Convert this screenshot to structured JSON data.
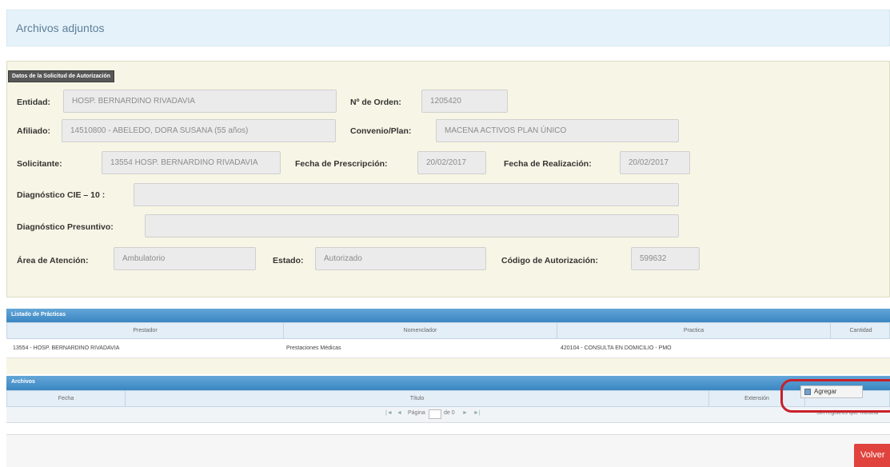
{
  "header": {
    "title": "Archivos adjuntos"
  },
  "solicitud": {
    "section_label": "Datos de la Solicitud de Autorización",
    "fields": {
      "entidad": {
        "label": "Entidad:",
        "value": "HOSP. BERNARDINO RIVADAVIA"
      },
      "nro_orden": {
        "label": "Nº de Orden:",
        "value": "1205420"
      },
      "afiliado": {
        "label": "Afiliado:",
        "value": "14510800 - ABELEDO, DORA SUSANA (55 años)"
      },
      "convenio": {
        "label": "Convenio/Plan:",
        "value": "MACENA ACTIVOS PLAN ÚNICO"
      },
      "solicitante": {
        "label": "Solicitante:",
        "value": "13554 HOSP. BERNARDINO RIVADAVIA"
      },
      "fecha_prescripcion": {
        "label": "Fecha de Prescripción:",
        "value": "20/02/2017"
      },
      "fecha_realizacion": {
        "label": "Fecha de Realización:",
        "value": "20/02/2017"
      },
      "diagnostico_cie": {
        "label": "Diagnóstico CIE – 10 :",
        "value": ""
      },
      "diagnostico_presuntivo": {
        "label": "Diagnóstico Presuntivo:",
        "value": ""
      },
      "area_atencion": {
        "label": "Área de Atención:",
        "value": "Ambulatorio"
      },
      "estado": {
        "label": "Estado:",
        "value": "Autorizado"
      },
      "codigo_autorizacion": {
        "label": "Código de Autorización:",
        "value": "599632"
      }
    }
  },
  "practicas": {
    "title": "Listado de Prácticas",
    "columns": [
      "Prestador",
      "Nomenclador",
      "Practica",
      "Cantidad"
    ],
    "rows": [
      {
        "prestador": "13554 - HOSP. BERNARDINO RIVADAVIA",
        "nomenclador": "Prestaciones Médicas",
        "practica": "420104 - CONSULTA EN DOMICILIO - PMO",
        "cantidad": ""
      }
    ]
  },
  "archivos": {
    "title": "Archivos",
    "columns": [
      "Fecha",
      "Título",
      "Extensión"
    ],
    "add_button_label": "Agregar",
    "pager": {
      "first": "|◄",
      "prev": "◄",
      "page_label": "Página",
      "page_value": "",
      "of_label": "de 0",
      "next": "►",
      "last": "►|"
    },
    "empty_message": "Sin registros que mostrar"
  },
  "footer": {
    "volver_label": "Volver"
  },
  "colors": {
    "header_bg": "#e6f2fa",
    "grid_bar": "#3a86c2",
    "volver": "#e0433d",
    "highlight_circle": "#c9202a"
  }
}
